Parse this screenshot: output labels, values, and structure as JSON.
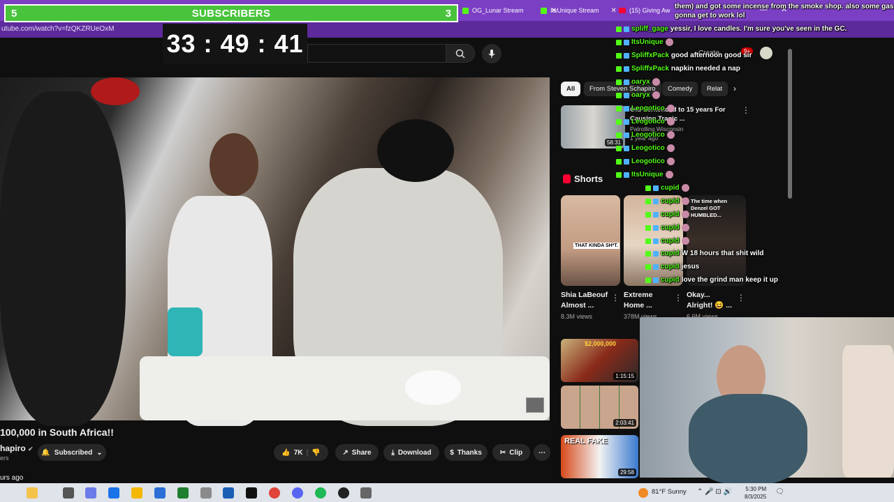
{
  "browser": {
    "url": "utube.com/watch?v=fzQKZRUeOxM",
    "tabs": [
      {
        "label": "OG_Lunar Stream",
        "icon": "kick-icon"
      },
      {
        "label": "ItsUnique Stream",
        "icon": "kick-icon"
      },
      {
        "label": "(15) Giving Aw",
        "icon": "youtube-icon"
      }
    ]
  },
  "overlay": {
    "subscribers": {
      "left": "5",
      "label": "SUBSCRIBERS",
      "right": "3"
    },
    "timer": "33 : 49 : 41"
  },
  "video": {
    "title": "100,000 in South Africa!!",
    "channel": "hapiro",
    "channel_sub": "ers",
    "subscribed_label": "Subscribed",
    "likes": "7K",
    "share_label": "Share",
    "download_label": "Download",
    "thanks_label": "Thanks",
    "clip_label": "Clip",
    "ago": "urs ago"
  },
  "header": {
    "create_label": "Create",
    "notif_count": "9+"
  },
  "chips": [
    "All",
    "From Steven Schapiro",
    "Comedy",
    "Relat"
  ],
  "recommended": {
    "title": "Old Sentenced to 15 years For Causing Tragic ...",
    "channel": "Patrolling Wisconsin",
    "meta": "1 year ago",
    "duration": "58:31"
  },
  "shorts": {
    "heading": "Shorts",
    "items": [
      {
        "title": "Shia LaBeouf Almost ...",
        "views": "8.3M views",
        "caption": "THAT KINDA SH*T."
      },
      {
        "title": "Extreme Home ...",
        "views": "378M views",
        "caption": ""
      },
      {
        "title": "Okay... Alright! 😆 ...",
        "views": "6.6M views",
        "caption": "The time when Denzel GOT HUMBLED..."
      }
    ]
  },
  "side_videos": [
    {
      "duration": "1:15:15",
      "label": "$2,000,000"
    },
    {
      "duration": "2:03:41",
      "label": ""
    },
    {
      "duration": "29:58",
      "label": "REAL FAKE"
    }
  ],
  "chat": [
    {
      "user": "",
      "text": "them) and got some incense from the smoke shop. also some gas ca"
    },
    {
      "user": "",
      "text": "gonna get to work lol"
    },
    {
      "user": "spliff_gage",
      "text": "yessir, I love candles. I'm sure you've seen in the GC."
    },
    {
      "user": "ItsUnique",
      "text": ""
    },
    {
      "user": "SpliffxPack",
      "text": "good afternoon good sir"
    },
    {
      "user": "SpliffxPack",
      "text": "napkin needed a nap"
    },
    {
      "user": "oaryx",
      "text": ""
    },
    {
      "user": "oaryx",
      "text": ""
    },
    {
      "user": "Leogotico",
      "text": ""
    },
    {
      "user": "Leogotico",
      "text": ""
    },
    {
      "user": "Leogotico",
      "text": ""
    },
    {
      "user": "Leogotico",
      "text": ""
    },
    {
      "user": "Leogotico",
      "text": ""
    },
    {
      "user": "ItsUnique",
      "text": ""
    },
    {
      "user": "cupid",
      "text": ""
    },
    {
      "user": "cupid",
      "text": ""
    },
    {
      "user": "cupid",
      "text": ""
    },
    {
      "user": "cupid",
      "text": ""
    },
    {
      "user": "cupid",
      "text": ""
    },
    {
      "user": "cupid",
      "text": "W 18 hours that shit wild"
    },
    {
      "user": "cupid",
      "text": "jesus"
    },
    {
      "user": "cupid",
      "text": "love the grind man keep it up"
    }
  ],
  "taskbar": {
    "weather": "81°F  Sunny",
    "time": "5:30 PM",
    "date": "8/3/2025"
  },
  "colors": {
    "accent": "#53fc18",
    "purple": "#7b3fc4",
    "youtube_red": "#ff0033"
  }
}
